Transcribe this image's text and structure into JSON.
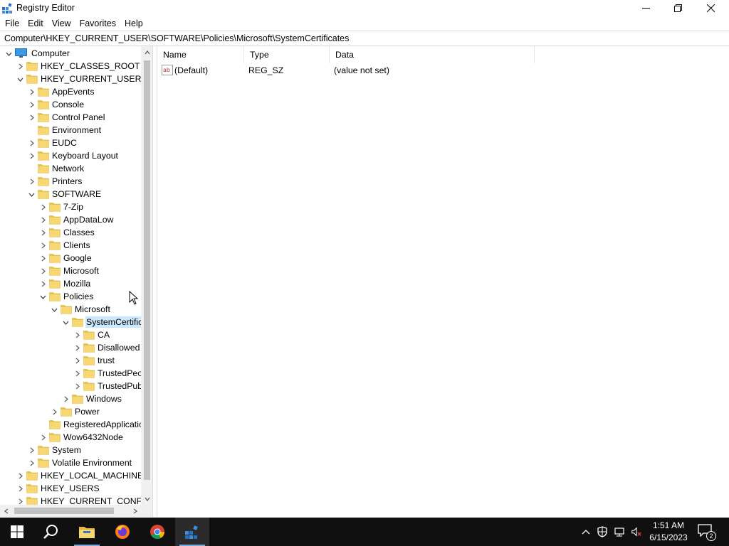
{
  "window": {
    "title": "Registry Editor"
  },
  "menu": [
    "File",
    "Edit",
    "View",
    "Favorites",
    "Help"
  ],
  "address": "Computer\\HKEY_CURRENT_USER\\SOFTWARE\\Policies\\Microsoft\\SystemCertificates",
  "tree": [
    {
      "label": "Computer",
      "level": 0,
      "state": "expanded",
      "icon": "computer-icon"
    },
    {
      "label": "HKEY_CLASSES_ROOT",
      "level": 1,
      "state": "collapsed"
    },
    {
      "label": "HKEY_CURRENT_USER",
      "level": 1,
      "state": "expanded"
    },
    {
      "label": "AppEvents",
      "level": 2,
      "state": "collapsed"
    },
    {
      "label": "Console",
      "level": 2,
      "state": "collapsed"
    },
    {
      "label": "Control Panel",
      "level": 2,
      "state": "collapsed"
    },
    {
      "label": "Environment",
      "level": 2,
      "state": "leaf"
    },
    {
      "label": "EUDC",
      "level": 2,
      "state": "collapsed"
    },
    {
      "label": "Keyboard Layout",
      "level": 2,
      "state": "collapsed"
    },
    {
      "label": "Network",
      "level": 2,
      "state": "leaf"
    },
    {
      "label": "Printers",
      "level": 2,
      "state": "collapsed"
    },
    {
      "label": "SOFTWARE",
      "level": 2,
      "state": "expanded"
    },
    {
      "label": "7-Zip",
      "level": 3,
      "state": "collapsed"
    },
    {
      "label": "AppDataLow",
      "level": 3,
      "state": "collapsed"
    },
    {
      "label": "Classes",
      "level": 3,
      "state": "collapsed"
    },
    {
      "label": "Clients",
      "level": 3,
      "state": "collapsed"
    },
    {
      "label": "Google",
      "level": 3,
      "state": "collapsed"
    },
    {
      "label": "Microsoft",
      "level": 3,
      "state": "collapsed"
    },
    {
      "label": "Mozilla",
      "level": 3,
      "state": "collapsed"
    },
    {
      "label": "Policies",
      "level": 3,
      "state": "expanded"
    },
    {
      "label": "Microsoft",
      "level": 4,
      "state": "expanded"
    },
    {
      "label": "SystemCertific",
      "level": 5,
      "state": "expanded",
      "selected": true
    },
    {
      "label": "CA",
      "level": 6,
      "state": "collapsed"
    },
    {
      "label": "Disallowed",
      "level": 6,
      "state": "collapsed"
    },
    {
      "label": "trust",
      "level": 6,
      "state": "collapsed"
    },
    {
      "label": "TrustedPeo",
      "level": 6,
      "state": "collapsed"
    },
    {
      "label": "TrustedPub",
      "level": 6,
      "state": "collapsed"
    },
    {
      "label": "Windows",
      "level": 5,
      "state": "collapsed"
    },
    {
      "label": "Power",
      "level": 4,
      "state": "collapsed"
    },
    {
      "label": "RegisteredApplicatic",
      "level": 3,
      "state": "leaf"
    },
    {
      "label": "Wow6432Node",
      "level": 3,
      "state": "collapsed"
    },
    {
      "label": "System",
      "level": 2,
      "state": "collapsed"
    },
    {
      "label": "Volatile Environment",
      "level": 2,
      "state": "collapsed"
    },
    {
      "label": "HKEY_LOCAL_MACHINE",
      "level": 1,
      "state": "collapsed"
    },
    {
      "label": "HKEY_USERS",
      "level": 1,
      "state": "collapsed"
    },
    {
      "label": "HKEY_CURRENT_CONFIG",
      "level": 1,
      "state": "collapsed"
    }
  ],
  "list": {
    "columns": [
      "Name",
      "Type",
      "Data"
    ],
    "rows": [
      {
        "name": "(Default)",
        "type": "REG_SZ",
        "data": "(value not set)",
        "icon": "string-value-icon"
      }
    ]
  },
  "taskbar": {
    "apps": [
      "start-icon",
      "search-icon",
      "file-explorer-icon",
      "firefox-icon",
      "chrome-icon",
      "registry-editor-icon"
    ],
    "active_app": "registry-editor-icon",
    "time": "1:51 AM",
    "date": "6/15/2023",
    "notification_count": "2"
  },
  "colors": {
    "selection": "#cce8ff",
    "folder": "#f7d774",
    "taskbar": "#101010"
  }
}
